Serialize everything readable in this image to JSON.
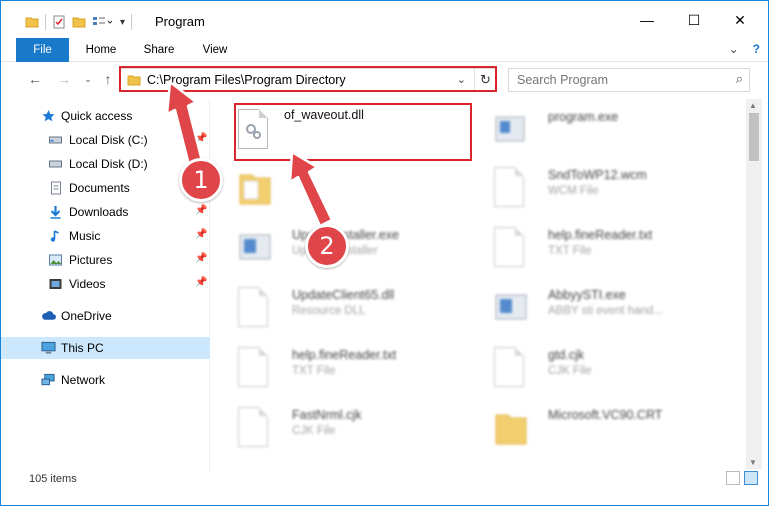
{
  "window": {
    "title": "Program",
    "controls": {
      "minimize": "—",
      "maximize": "☐",
      "close": "✕"
    }
  },
  "ribbon": {
    "tabs": [
      "File",
      "Home",
      "Share",
      "View"
    ],
    "expand_glyph": "⌄",
    "help_glyph": "?"
  },
  "address": {
    "path": "C:\\Program Files\\Program Directory",
    "dropdown_glyph": "⌄",
    "refresh_glyph": "↻"
  },
  "search": {
    "placeholder": "Search Program",
    "icon": "search-icon"
  },
  "sidebar": {
    "items": [
      {
        "label": "Quick access",
        "icon": "star-icon",
        "pinned": false
      },
      {
        "label": "Local Disk (C:)",
        "icon": "drive-icon",
        "pinned": true
      },
      {
        "label": "Local Disk (D:)",
        "icon": "drive-icon",
        "pinned": false
      },
      {
        "label": "Documents",
        "icon": "documents-icon",
        "pinned": true
      },
      {
        "label": "Downloads",
        "icon": "download-icon",
        "pinned": true
      },
      {
        "label": "Music",
        "icon": "music-icon",
        "pinned": true
      },
      {
        "label": "Pictures",
        "icon": "pictures-icon",
        "pinned": true
      },
      {
        "label": "Videos",
        "icon": "videos-icon",
        "pinned": true
      },
      {
        "label": "OneDrive",
        "icon": "cloud-icon",
        "pinned": false
      },
      {
        "label": "This PC",
        "icon": "computer-icon",
        "pinned": false,
        "selected": true
      },
      {
        "label": "Network",
        "icon": "network-icon",
        "pinned": false
      }
    ]
  },
  "files": [
    {
      "name": "of_waveout.dll",
      "type": "",
      "icon": "dll-icon",
      "highlighted": true
    },
    {
      "name": "program.exe",
      "type": "",
      "icon": "exe-icon"
    },
    {
      "name": "",
      "type": "",
      "icon": "folder-icon"
    },
    {
      "name": "SndToWP12.wcm",
      "type": "WCM File",
      "icon": "file-icon"
    },
    {
      "name": "UpdateInstaller.exe",
      "type": "Updates installer",
      "icon": "exe-icon"
    },
    {
      "name": "help.fineReader.txt",
      "type": "TXT File",
      "icon": "file-icon"
    },
    {
      "name": "UpdateClient65.dll",
      "type": "Resource DLL",
      "icon": "dll-icon"
    },
    {
      "name": "AbbyySTI.exe",
      "type": "ABBY sti event hand...",
      "icon": "exe-icon"
    },
    {
      "name": "help.fineReader.txt",
      "type": "TXT File",
      "icon": "file-icon"
    },
    {
      "name": "gtd.cjk",
      "type": "CJK File",
      "icon": "file-icon"
    },
    {
      "name": "FastNrml.cjk",
      "type": "CJK File",
      "icon": "file-icon"
    },
    {
      "name": "Microsoft.VC90.CRT",
      "type": "",
      "icon": "folder-icon"
    }
  ],
  "status": {
    "item_count": "105 items"
  },
  "annotations": {
    "step1": "1",
    "step2": "2"
  },
  "colors": {
    "accent": "#1979ca",
    "highlight": "#d9262c",
    "badge": "#e0454a",
    "selected": "#cce8ff"
  }
}
